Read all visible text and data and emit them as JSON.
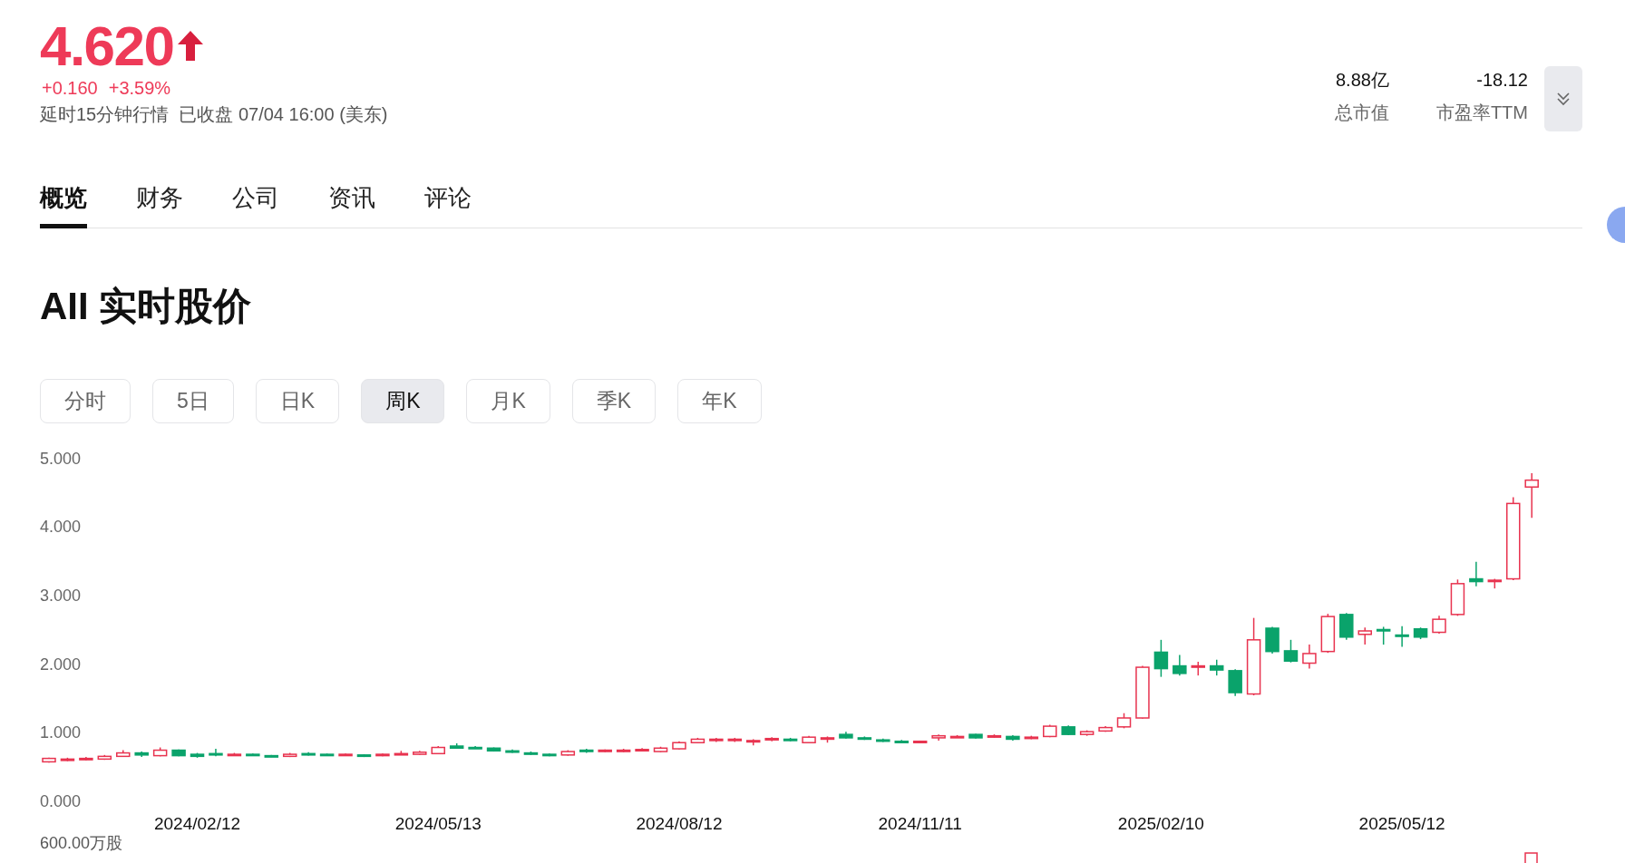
{
  "quote": {
    "price": "4.620",
    "change": "+0.160",
    "change_percent": "+3.59%",
    "status": "延时15分钟行情  已收盘 07/04 16:00 (美东)"
  },
  "stats": [
    {
      "value": "8.88亿",
      "label": "总市值"
    },
    {
      "value": "-18.12",
      "label": "市盈率TTM"
    }
  ],
  "tabs": [
    {
      "label": "概览",
      "selected": true
    },
    {
      "label": "财务",
      "selected": false
    },
    {
      "label": "公司",
      "selected": false
    },
    {
      "label": "资讯",
      "selected": false
    },
    {
      "label": "评论",
      "selected": false
    }
  ],
  "section_title": "AII 实时股价",
  "periods": [
    {
      "label": "分时",
      "selected": false
    },
    {
      "label": "5日",
      "selected": false
    },
    {
      "label": "日K",
      "selected": false
    },
    {
      "label": "周K",
      "selected": true
    },
    {
      "label": "月K",
      "selected": false
    },
    {
      "label": "季K",
      "selected": false
    },
    {
      "label": "年K",
      "selected": false
    }
  ],
  "chart": {
    "chart_data": {
      "type": "candlestick",
      "ylim": [
        0,
        5
      ],
      "yticks": [
        {
          "value": 5,
          "label": "5.000"
        },
        {
          "value": 4,
          "label": "4.000"
        },
        {
          "value": 3,
          "label": "3.000"
        },
        {
          "value": 2,
          "label": "2.000"
        },
        {
          "value": 1,
          "label": "1.000"
        },
        {
          "value": 0,
          "label": "0.000"
        }
      ],
      "categories": [
        null,
        null,
        null,
        null,
        null,
        null,
        null,
        null,
        "2024/02/12",
        null,
        null,
        null,
        null,
        null,
        null,
        null,
        null,
        null,
        null,
        null,
        null,
        "2024/05/13",
        null,
        null,
        null,
        null,
        null,
        null,
        null,
        null,
        null,
        null,
        null,
        null,
        "2024/08/12",
        null,
        null,
        null,
        null,
        null,
        null,
        null,
        null,
        null,
        null,
        null,
        null,
        "2024/11/11",
        null,
        null,
        null,
        null,
        null,
        null,
        null,
        null,
        null,
        null,
        null,
        null,
        "2025/02/10",
        null,
        null,
        null,
        null,
        null,
        null,
        null,
        null,
        null,
        null,
        null,
        null,
        "2025/05/12",
        null,
        null,
        null,
        null,
        null,
        null,
        null
      ],
      "ohlc": [
        [
          0.59,
          0.65,
          0.58,
          0.64
        ],
        [
          0.62,
          0.65,
          0.6,
          0.63
        ],
        [
          0.63,
          0.66,
          0.61,
          0.64
        ],
        [
          0.63,
          0.69,
          0.62,
          0.67
        ],
        [
          0.67,
          0.76,
          0.66,
          0.72
        ],
        [
          0.72,
          0.74,
          0.66,
          0.69
        ],
        [
          0.68,
          0.8,
          0.67,
          0.76
        ],
        [
          0.76,
          0.77,
          0.67,
          0.68
        ],
        [
          0.7,
          0.72,
          0.65,
          0.67
        ],
        [
          0.71,
          0.78,
          0.67,
          0.69
        ],
        [
          0.69,
          0.72,
          0.68,
          0.7
        ],
        [
          0.7,
          0.71,
          0.68,
          0.69
        ],
        [
          0.68,
          0.69,
          0.66,
          0.67
        ],
        [
          0.67,
          0.72,
          0.66,
          0.7
        ],
        [
          0.71,
          0.73,
          0.68,
          0.69
        ],
        [
          0.7,
          0.71,
          0.68,
          0.69
        ],
        [
          0.69,
          0.71,
          0.68,
          0.7
        ],
        [
          0.69,
          0.7,
          0.66,
          0.67
        ],
        [
          0.68,
          0.71,
          0.67,
          0.7
        ],
        [
          0.7,
          0.75,
          0.69,
          0.71
        ],
        [
          0.7,
          0.75,
          0.69,
          0.73
        ],
        [
          0.71,
          0.82,
          0.7,
          0.8
        ],
        [
          0.82,
          0.86,
          0.78,
          0.79
        ],
        [
          0.8,
          0.82,
          0.78,
          0.79
        ],
        [
          0.79,
          0.8,
          0.74,
          0.75
        ],
        [
          0.75,
          0.77,
          0.72,
          0.73
        ],
        [
          0.72,
          0.74,
          0.69,
          0.7
        ],
        [
          0.7,
          0.71,
          0.67,
          0.68
        ],
        [
          0.69,
          0.76,
          0.68,
          0.74
        ],
        [
          0.76,
          0.78,
          0.72,
          0.74
        ],
        [
          0.74,
          0.77,
          0.73,
          0.76
        ],
        [
          0.74,
          0.78,
          0.73,
          0.76
        ],
        [
          0.76,
          0.79,
          0.75,
          0.77
        ],
        [
          0.74,
          0.81,
          0.73,
          0.79
        ],
        [
          0.78,
          0.89,
          0.77,
          0.87
        ],
        [
          0.87,
          0.94,
          0.86,
          0.92
        ],
        [
          0.9,
          0.94,
          0.88,
          0.92
        ],
        [
          0.9,
          0.94,
          0.88,
          0.92
        ],
        [
          0.88,
          0.92,
          0.83,
          0.9
        ],
        [
          0.91,
          0.95,
          0.89,
          0.93
        ],
        [
          0.92,
          0.94,
          0.89,
          0.9
        ],
        [
          0.87,
          0.97,
          0.86,
          0.95
        ],
        [
          0.93,
          0.96,
          0.87,
          0.94
        ],
        [
          0.99,
          1.03,
          0.93,
          0.94
        ],
        [
          0.94,
          0.96,
          0.91,
          0.92
        ],
        [
          0.91,
          0.93,
          0.88,
          0.9
        ],
        [
          0.89,
          0.91,
          0.87,
          0.88
        ],
        [
          0.87,
          0.9,
          0.86,
          0.89
        ],
        [
          0.94,
          0.99,
          0.9,
          0.97
        ],
        [
          0.95,
          0.98,
          0.94,
          0.96
        ],
        [
          0.99,
          1.0,
          0.93,
          0.94
        ],
        [
          0.95,
          0.99,
          0.94,
          0.97
        ],
        [
          0.96,
          0.98,
          0.9,
          0.92
        ],
        [
          0.93,
          0.97,
          0.92,
          0.95
        ],
        [
          0.96,
          1.13,
          0.95,
          1.11
        ],
        [
          1.1,
          1.12,
          0.98,
          0.99
        ],
        [
          0.99,
          1.05,
          0.97,
          1.03
        ],
        [
          1.04,
          1.11,
          1.03,
          1.09
        ],
        [
          1.1,
          1.3,
          1.08,
          1.23
        ],
        [
          1.23,
          1.99,
          1.22,
          1.97
        ],
        [
          2.19,
          2.37,
          1.83,
          1.95
        ],
        [
          1.99,
          2.15,
          1.85,
          1.88
        ],
        [
          1.97,
          2.05,
          1.85,
          1.99
        ],
        [
          1.99,
          2.08,
          1.85,
          1.93
        ],
        [
          1.92,
          1.94,
          1.55,
          1.6
        ],
        [
          1.58,
          2.69,
          1.56,
          2.37
        ],
        [
          2.54,
          2.56,
          2.17,
          2.2
        ],
        [
          2.21,
          2.37,
          2.04,
          2.06
        ],
        [
          2.03,
          2.3,
          1.95,
          2.17
        ],
        [
          2.2,
          2.75,
          2.18,
          2.71
        ],
        [
          2.74,
          2.76,
          2.37,
          2.41
        ],
        [
          2.45,
          2.55,
          2.3,
          2.5
        ],
        [
          2.52,
          2.56,
          2.3,
          2.5
        ],
        [
          2.44,
          2.57,
          2.27,
          2.42
        ],
        [
          2.53,
          2.55,
          2.38,
          2.41
        ],
        [
          2.48,
          2.72,
          2.46,
          2.67
        ],
        [
          2.74,
          3.25,
          2.72,
          3.19
        ],
        [
          3.26,
          3.51,
          3.15,
          3.22
        ],
        [
          3.23,
          3.26,
          3.12,
          3.24
        ],
        [
          3.26,
          4.45,
          3.24,
          4.36
        ],
        [
          4.6,
          4.8,
          4.15,
          4.7
        ]
      ]
    },
    "volume_label": "600.00万股"
  }
}
